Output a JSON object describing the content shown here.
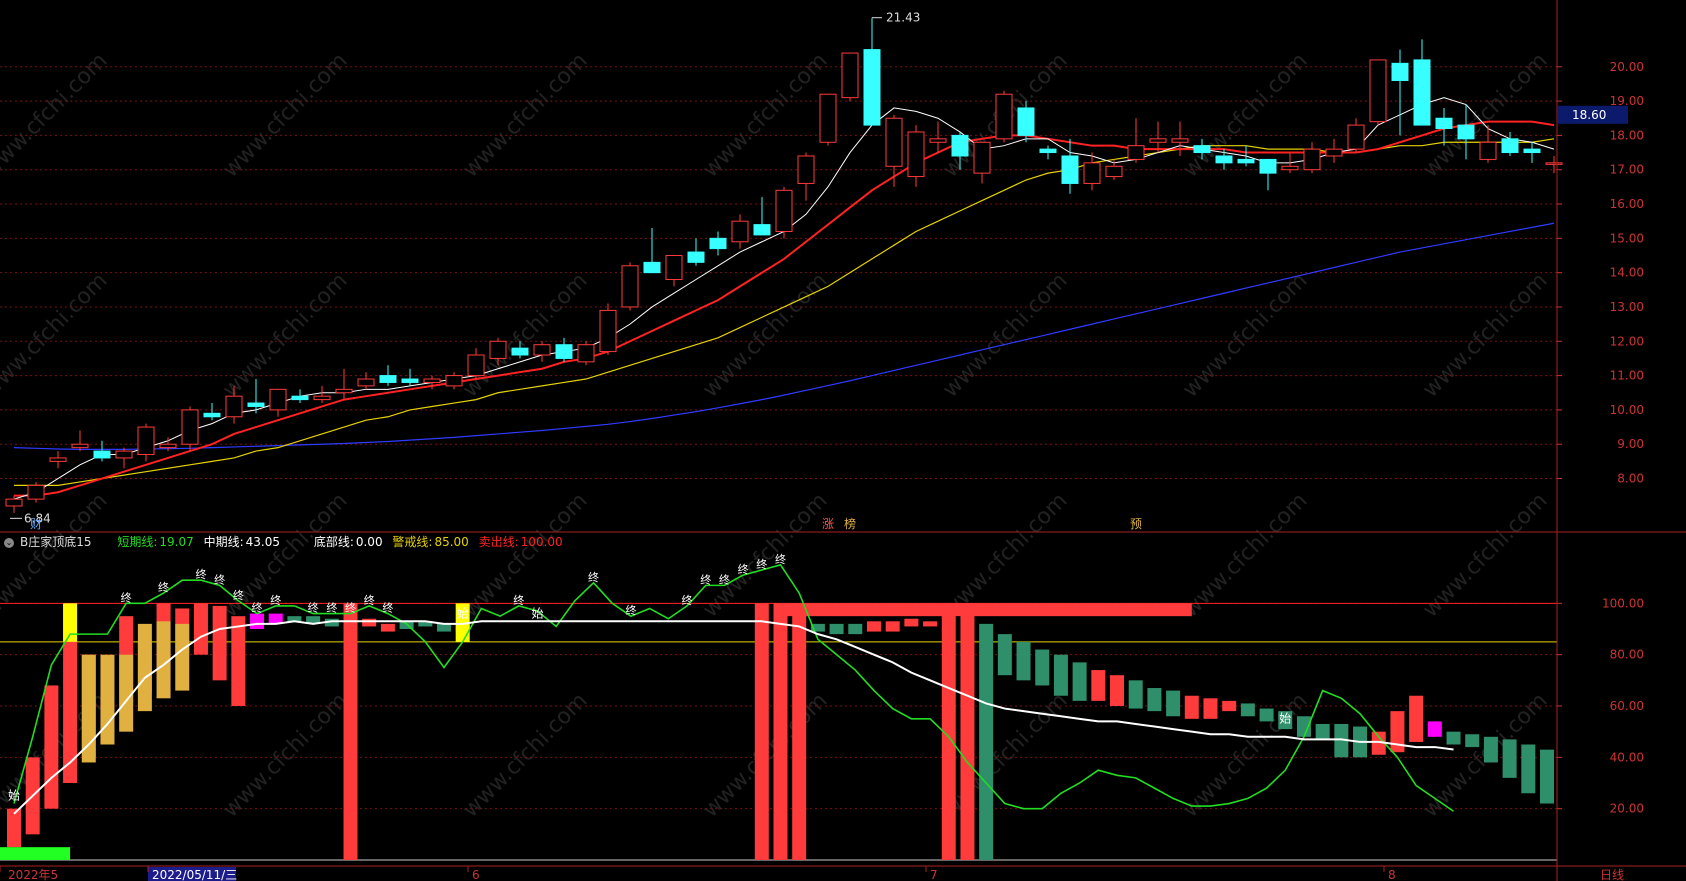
{
  "indicator_header": {
    "name": "B庄家顶底15",
    "short_label": "短期线:",
    "short_value": "19.07",
    "mid_label": "中期线:",
    "mid_value": "43.05",
    "bottom_label": "底部线:",
    "bottom_value": "0.00",
    "warn_label": "警戒线:",
    "warn_value": "85.00",
    "sell_label": "卖出线:",
    "sell_value": "100.00"
  },
  "colors": {
    "up": "#ff3b3b",
    "down": "#37ffff",
    "ma5": "#ffffff",
    "ma10": "#ff2222",
    "ma20": "#e6d200",
    "ma60": "#2f3bff",
    "short_line": "#22dd22",
    "warn_line": "#e6d200",
    "sell_line": "#ff2222",
    "grid": "#7a1010",
    "axis_text": "#cc3333",
    "green_bar": "#2f8f6a",
    "gold_bar": "#e0b040",
    "magenta_bar": "#ff00ff",
    "yellow_bar": "#ffff00"
  },
  "price_label": "18.60",
  "x_axis": [
    "2022年5",
    "2022/05/11/三",
    "6",
    "7",
    "8"
  ],
  "corner_label": "日线",
  "watermark": "www.cfchi.com",
  "annotations": {
    "high": "21.43",
    "low": "6.84",
    "cai": "财",
    "zhang": "涨",
    "bang": "榜",
    "yu": "预"
  },
  "markers": {
    "shi": "始",
    "zhong": "终"
  },
  "chart_data": [
    {
      "type": "candlestick",
      "ylim": [
        6.5,
        21.8
      ],
      "y_ticks": [
        8.0,
        9.0,
        10.0,
        11.0,
        12.0,
        13.0,
        14.0,
        15.0,
        16.0,
        17.0,
        18.0,
        19.0,
        20.0
      ],
      "candles": [
        [
          7.2,
          7.5,
          7.0,
          7.4
        ],
        [
          7.4,
          7.9,
          7.3,
          7.8
        ],
        [
          8.5,
          8.8,
          8.3,
          8.6
        ],
        [
          8.9,
          9.4,
          8.8,
          9.0
        ],
        [
          8.8,
          9.1,
          8.5,
          8.6
        ],
        [
          8.6,
          8.9,
          8.3,
          8.8
        ],
        [
          8.7,
          9.6,
          8.5,
          9.5
        ],
        [
          8.9,
          9.2,
          8.8,
          9.0
        ],
        [
          9.0,
          10.1,
          8.8,
          10.0
        ],
        [
          9.9,
          10.2,
          9.7,
          9.8
        ],
        [
          9.8,
          10.7,
          9.6,
          10.4
        ],
        [
          10.2,
          10.9,
          9.9,
          10.1
        ],
        [
          10.0,
          10.5,
          9.8,
          10.6
        ],
        [
          10.4,
          10.6,
          10.2,
          10.3
        ],
        [
          10.3,
          10.7,
          10.2,
          10.4
        ],
        [
          10.5,
          11.2,
          10.3,
          10.6
        ],
        [
          10.7,
          11.1,
          10.6,
          10.9
        ],
        [
          11.0,
          11.3,
          10.7,
          10.8
        ],
        [
          10.9,
          11.2,
          10.7,
          10.8
        ],
        [
          10.8,
          11.0,
          10.6,
          10.9
        ],
        [
          10.7,
          11.1,
          10.6,
          11.0
        ],
        [
          11.0,
          11.8,
          10.9,
          11.6
        ],
        [
          11.5,
          12.1,
          11.3,
          12.0
        ],
        [
          11.8,
          12.0,
          11.5,
          11.6
        ],
        [
          11.6,
          12.0,
          11.4,
          11.9
        ],
        [
          11.9,
          12.1,
          11.4,
          11.5
        ],
        [
          11.4,
          12.0,
          11.3,
          11.9
        ],
        [
          11.7,
          13.1,
          11.6,
          12.9
        ],
        [
          13.0,
          14.3,
          12.9,
          14.2
        ],
        [
          14.3,
          15.3,
          14.1,
          14.0
        ],
        [
          13.8,
          14.5,
          13.6,
          14.5
        ],
        [
          14.6,
          15.0,
          14.2,
          14.3
        ],
        [
          15.0,
          15.2,
          14.5,
          14.7
        ],
        [
          14.9,
          15.7,
          14.7,
          15.5
        ],
        [
          15.4,
          16.2,
          15.1,
          15.1
        ],
        [
          15.2,
          16.5,
          15.0,
          16.4
        ],
        [
          16.6,
          17.5,
          16.1,
          17.4
        ],
        [
          17.8,
          19.2,
          17.7,
          19.2
        ],
        [
          19.1,
          20.4,
          19.0,
          20.4
        ],
        [
          20.5,
          21.43,
          20.3,
          18.3
        ],
        [
          17.1,
          18.6,
          16.5,
          18.5
        ],
        [
          16.8,
          18.3,
          16.5,
          18.1
        ],
        [
          17.8,
          18.4,
          17.5,
          17.9
        ],
        [
          18.0,
          18.1,
          17.0,
          17.4
        ],
        [
          16.9,
          17.8,
          16.6,
          17.8
        ],
        [
          17.9,
          19.3,
          17.8,
          19.2
        ],
        [
          18.8,
          19.0,
          17.8,
          18.0
        ],
        [
          17.6,
          17.7,
          17.3,
          17.5
        ],
        [
          17.4,
          17.9,
          16.3,
          16.6
        ],
        [
          16.6,
          17.5,
          16.4,
          17.2
        ],
        [
          16.8,
          17.3,
          16.7,
          17.1
        ],
        [
          17.3,
          18.5,
          17.2,
          17.7
        ],
        [
          17.8,
          18.4,
          17.5,
          17.9
        ],
        [
          17.8,
          18.4,
          17.4,
          17.9
        ],
        [
          17.7,
          17.9,
          17.3,
          17.5
        ],
        [
          17.4,
          17.6,
          17.0,
          17.2
        ],
        [
          17.3,
          17.7,
          17.1,
          17.2
        ],
        [
          17.3,
          17.3,
          16.4,
          16.9
        ],
        [
          17.0,
          17.5,
          16.9,
          17.1
        ],
        [
          17.0,
          17.8,
          16.9,
          17.6
        ],
        [
          17.4,
          17.9,
          17.2,
          17.6
        ],
        [
          17.6,
          18.5,
          17.5,
          18.3
        ],
        [
          18.4,
          20.2,
          18.3,
          20.2
        ],
        [
          20.1,
          20.5,
          18.0,
          19.6
        ],
        [
          20.2,
          20.8,
          18.6,
          18.3
        ],
        [
          18.5,
          18.8,
          17.7,
          18.2
        ],
        [
          18.3,
          18.9,
          17.3,
          17.9
        ],
        [
          17.3,
          18.3,
          17.2,
          17.8
        ],
        [
          17.9,
          18.1,
          17.4,
          17.5
        ],
        [
          17.6,
          17.8,
          17.2,
          17.5
        ],
        [
          17.2,
          17.4,
          16.9,
          17.2
        ]
      ],
      "ma5": [
        7.4,
        7.6,
        8.0,
        8.4,
        8.7,
        8.7,
        8.9,
        9.1,
        9.4,
        9.6,
        9.9,
        10.0,
        10.2,
        10.4,
        10.5,
        10.5,
        10.6,
        10.6,
        10.7,
        10.8,
        10.9,
        11.0,
        11.2,
        11.4,
        11.6,
        11.7,
        11.8,
        12.1,
        12.5,
        13.0,
        13.4,
        13.8,
        14.2,
        14.6,
        14.9,
        15.2,
        15.7,
        16.5,
        17.5,
        18.3,
        18.8,
        18.7,
        18.5,
        18.1,
        17.6,
        17.7,
        17.9,
        17.9,
        17.5,
        17.4,
        17.2,
        17.3,
        17.5,
        17.7,
        17.6,
        17.5,
        17.4,
        17.2,
        17.2,
        17.3,
        17.5,
        17.6,
        18.3,
        18.6,
        18.9,
        19.1,
        18.9,
        18.2,
        17.9,
        17.8,
        17.6
      ],
      "ma10": [
        7.5,
        7.5,
        7.6,
        7.8,
        8.0,
        8.2,
        8.4,
        8.6,
        8.8,
        9.0,
        9.3,
        9.5,
        9.7,
        9.9,
        10.1,
        10.3,
        10.4,
        10.5,
        10.6,
        10.7,
        10.8,
        10.9,
        11.0,
        11.1,
        11.2,
        11.4,
        11.5,
        11.7,
        12.0,
        12.3,
        12.6,
        12.9,
        13.2,
        13.6,
        14.0,
        14.4,
        14.9,
        15.4,
        15.9,
        16.4,
        16.8,
        17.2,
        17.5,
        17.8,
        17.9,
        18.0,
        18.0,
        17.9,
        17.8,
        17.7,
        17.7,
        17.6,
        17.6,
        17.6,
        17.6,
        17.6,
        17.5,
        17.5,
        17.5,
        17.5,
        17.5,
        17.5,
        17.6,
        17.8,
        18.0,
        18.2,
        18.3,
        18.4,
        18.4,
        18.4,
        18.3
      ],
      "ma20": [
        7.8,
        7.8,
        7.8,
        7.9,
        8.0,
        8.1,
        8.2,
        8.3,
        8.4,
        8.5,
        8.6,
        8.8,
        8.9,
        9.1,
        9.3,
        9.5,
        9.7,
        9.8,
        10.0,
        10.1,
        10.2,
        10.3,
        10.5,
        10.6,
        10.7,
        10.8,
        10.9,
        11.1,
        11.3,
        11.5,
        11.7,
        11.9,
        12.1,
        12.4,
        12.7,
        13.0,
        13.3,
        13.6,
        14.0,
        14.4,
        14.8,
        15.2,
        15.5,
        15.8,
        16.1,
        16.4,
        16.7,
        16.9,
        17.0,
        17.2,
        17.3,
        17.4,
        17.5,
        17.6,
        17.7,
        17.7,
        17.7,
        17.6,
        17.6,
        17.6,
        17.5,
        17.5,
        17.6,
        17.7,
        17.7,
        17.8,
        17.8,
        17.8,
        17.8,
        17.8,
        17.9
      ],
      "ma60": [
        8.9,
        8.88,
        8.86,
        8.85,
        8.85,
        8.85,
        8.86,
        8.87,
        8.88,
        8.9,
        8.92,
        8.94,
        8.96,
        8.98,
        9.0,
        9.02,
        9.05,
        9.08,
        9.12,
        9.16,
        9.2,
        9.25,
        9.3,
        9.35,
        9.4,
        9.46,
        9.52,
        9.58,
        9.66,
        9.75,
        9.85,
        9.95,
        10.06,
        10.18,
        10.3,
        10.43,
        10.57,
        10.71,
        10.85,
        11.0,
        11.15,
        11.3,
        11.45,
        11.6,
        11.75,
        11.9,
        12.05,
        12.2,
        12.35,
        12.5,
        12.65,
        12.8,
        12.95,
        13.1,
        13.25,
        13.4,
        13.55,
        13.7,
        13.85,
        14.0,
        14.15,
        14.3,
        14.45,
        14.6,
        14.72,
        14.84,
        14.96,
        15.08,
        15.2,
        15.32,
        15.44
      ]
    },
    {
      "type": "bar",
      "title": "B庄家顶底15",
      "ylim": [
        0,
        120
      ],
      "y_ticks": [
        20.0,
        40.0,
        60.0,
        80.0,
        100.0
      ],
      "reference_lines": {
        "warn": 85,
        "sell": 100
      },
      "short_line": [
        22,
        48,
        76,
        88,
        88,
        88,
        100,
        100,
        104,
        109,
        109,
        107,
        101,
        96,
        99,
        99,
        96,
        96,
        96,
        99,
        96,
        92,
        85,
        75,
        85,
        98,
        95,
        99,
        97,
        91,
        101,
        108,
        100,
        95,
        98,
        94,
        99,
        107,
        107,
        111,
        113,
        115,
        104,
        86,
        80,
        74,
        66,
        59,
        55,
        55,
        48,
        38,
        30,
        22,
        20,
        20,
        26,
        30,
        35,
        33,
        32,
        28,
        24,
        21,
        21,
        22,
        24,
        28,
        35,
        48,
        66,
        63,
        57,
        48,
        40,
        29,
        24,
        19
      ],
      "mid_line": [
        18,
        25,
        32,
        38,
        45,
        53,
        62,
        71,
        76,
        82,
        87,
        90,
        91,
        92,
        92,
        93,
        92,
        93,
        93,
        93,
        93,
        93,
        93,
        92,
        92,
        93,
        93,
        93,
        93,
        93,
        93,
        93,
        93,
        93,
        93,
        93,
        93,
        93,
        93,
        93,
        93,
        92,
        91,
        88,
        86,
        83,
        80,
        77,
        73,
        70,
        67,
        64,
        61,
        59,
        58,
        57,
        56,
        55,
        54,
        54,
        53,
        52,
        51,
        50,
        49,
        49,
        48,
        48,
        48,
        47,
        47,
        47,
        46,
        46,
        45,
        44,
        44,
        43.05
      ],
      "columns": [
        [
          5,
          20,
          "r"
        ],
        [
          10,
          40,
          "r"
        ],
        [
          20,
          68,
          "r"
        ],
        [
          30,
          100,
          "r"
        ],
        [
          40,
          80,
          "r"
        ],
        [
          50,
          62,
          "r"
        ],
        [
          60,
          95,
          "r"
        ],
        [
          65,
          85,
          "r"
        ],
        [
          70,
          100,
          "r"
        ],
        [
          80,
          98,
          "r"
        ],
        [
          80,
          100,
          "r"
        ],
        [
          70,
          99,
          "r"
        ],
        [
          60,
          95,
          "r"
        ],
        [
          90,
          96,
          "p"
        ],
        [
          92,
          96,
          "p"
        ],
        [
          93,
          95,
          "g"
        ],
        [
          92,
          95,
          "g"
        ],
        [
          91,
          94,
          "g"
        ],
        [
          0,
          100,
          "r"
        ],
        [
          91,
          94,
          "r"
        ],
        [
          89,
          92,
          "r"
        ],
        [
          90,
          93,
          "g"
        ],
        [
          91,
          93,
          "g"
        ],
        [
          89,
          92,
          "g"
        ],
        [
          89,
          92,
          "r"
        ],
        [
          0,
          0,
          "n"
        ],
        [
          0,
          0,
          "n"
        ],
        [
          0,
          0,
          "n"
        ],
        [
          0,
          0,
          "n"
        ],
        [
          0,
          0,
          "n"
        ],
        [
          0,
          0,
          "n"
        ],
        [
          0,
          0,
          "n"
        ],
        [
          0,
          0,
          "n"
        ],
        [
          0,
          0,
          "n"
        ],
        [
          0,
          0,
          "n"
        ],
        [
          0,
          0,
          "n"
        ],
        [
          0,
          0,
          "n"
        ],
        [
          0,
          0,
          "n"
        ],
        [
          0,
          0,
          "n"
        ],
        [
          0,
          0,
          "n"
        ],
        [
          0,
          100,
          "r"
        ],
        [
          0,
          100,
          "r"
        ],
        [
          0,
          100,
          "r"
        ],
        [
          89,
          92,
          "g"
        ],
        [
          88,
          92,
          "g"
        ],
        [
          88,
          92,
          "g"
        ],
        [
          89,
          93,
          "r"
        ],
        [
          89,
          93,
          "r"
        ],
        [
          91,
          94,
          "r"
        ],
        [
          91,
          93,
          "r"
        ],
        [
          0,
          100,
          "r"
        ],
        [
          0,
          100,
          "r"
        ],
        [
          0,
          92,
          "g"
        ],
        [
          72,
          88,
          "g"
        ],
        [
          70,
          85,
          "g"
        ],
        [
          68,
          82,
          "g"
        ],
        [
          64,
          80,
          "g"
        ],
        [
          62,
          77,
          "g"
        ],
        [
          62,
          74,
          "r"
        ],
        [
          60,
          72,
          "r"
        ],
        [
          59,
          70,
          "g"
        ],
        [
          58,
          67,
          "g"
        ],
        [
          56,
          66,
          "g"
        ],
        [
          55,
          64,
          "r"
        ],
        [
          55,
          63,
          "r"
        ],
        [
          58,
          62,
          "r"
        ],
        [
          56,
          61,
          "g"
        ],
        [
          54,
          59,
          "g"
        ],
        [
          51,
          58,
          "g"
        ],
        [
          48,
          56,
          "g"
        ],
        [
          47,
          53,
          "g"
        ],
        [
          40,
          53,
          "g"
        ],
        [
          40,
          52,
          "g"
        ],
        [
          41,
          50,
          "r"
        ],
        [
          42,
          58,
          "r"
        ],
        [
          46,
          64,
          "r"
        ],
        [
          48,
          54,
          "p"
        ],
        [
          45,
          50,
          "g"
        ],
        [
          44,
          49,
          "g"
        ],
        [
          38,
          48,
          "g"
        ],
        [
          32,
          47,
          "g"
        ],
        [
          26,
          45,
          "g"
        ],
        [
          22,
          43,
          "g"
        ]
      ]
    }
  ]
}
